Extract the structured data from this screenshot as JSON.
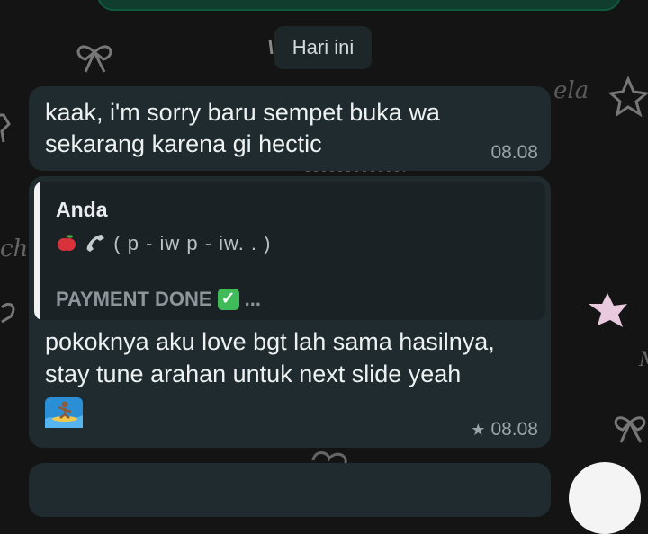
{
  "date_chip": {
    "label": "Hari ini"
  },
  "messages": [
    {
      "text_line1": "kaak, i'm sorry baru sempet buka wa",
      "text_line2": "sekarang karena gi hectic",
      "time": "08.08"
    },
    {
      "reply": {
        "author": "Anda",
        "line": "( p - iw p - iw. .  )",
        "payment": "PAYMENT DONE",
        "payment_suffix": "..."
      },
      "text_line1": "pokoknya aku love bgt lah sama hasilnya,",
      "text_line2": "stay tune arahan untuk next slide yeah",
      "time": "08.08"
    }
  ],
  "wallpaper_texts": {
    "t1": "ela",
    "t2": "cho",
    "t3": "M"
  },
  "colors": {
    "background": "#141414",
    "bubble": "#1f2b2e",
    "quote": "#1a2225",
    "check": "#3fbb5a",
    "wallpaper_motif": "#5a5a5a",
    "star_fill": "#e8c9de"
  }
}
